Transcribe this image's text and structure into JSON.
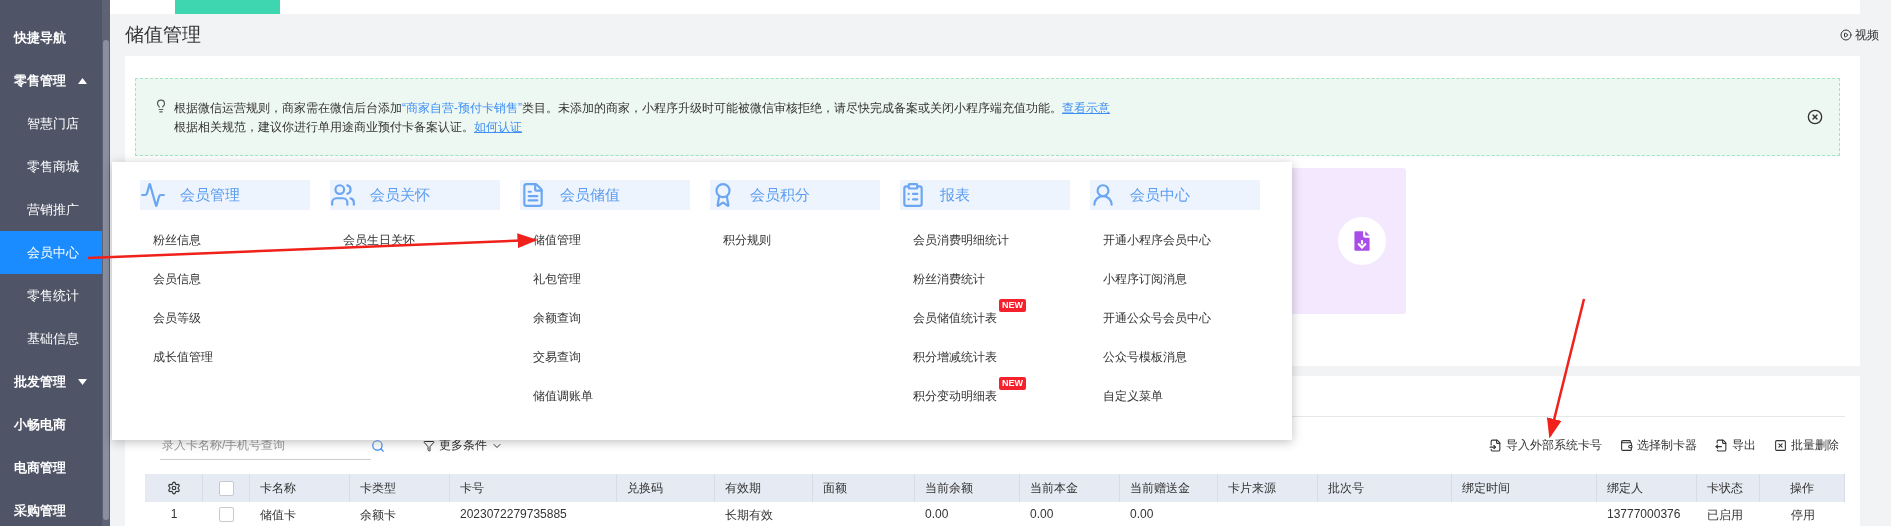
{
  "sidebar": {
    "items": [
      {
        "label": "快捷导航",
        "selected": false
      },
      {
        "label": "零售管理",
        "selected": false,
        "expanded": true,
        "children": [
          {
            "label": "智慧门店",
            "selected": false
          },
          {
            "label": "零售商城",
            "selected": false
          },
          {
            "label": "营销推广",
            "selected": false
          },
          {
            "label": "会员中心",
            "selected": true
          },
          {
            "label": "零售统计",
            "selected": false
          },
          {
            "label": "基础信息",
            "selected": false
          }
        ]
      },
      {
        "label": "批发管理",
        "selected": false,
        "expanded": false
      },
      {
        "label": "小畅电商",
        "selected": false
      },
      {
        "label": "电商管理",
        "selected": false
      },
      {
        "label": "采购管理",
        "selected": false
      }
    ]
  },
  "page": {
    "title": "储值管理",
    "video_link": "视频"
  },
  "notice": {
    "lines": [
      {
        "text_before": "根据微信运营规则，商家需在微信后台添加",
        "highlight": "“商家自营-预付卡销售”",
        "text_after": "类目。未添加的商家，小程序升级时可能被微信审核拒绝，请尽快完成备案或关闭小程序端充值功能。",
        "link": "查看示意"
      },
      {
        "text_before": "根据相关规范，建议你进行单用途商业预付卡备案认证。",
        "link": "如何认证"
      }
    ]
  },
  "mega_menu": {
    "columns": [
      {
        "title": "会员管理",
        "items": [
          {
            "label": "粉丝信息"
          },
          {
            "label": "会员信息"
          },
          {
            "label": "会员等级"
          },
          {
            "label": "成长值管理"
          }
        ]
      },
      {
        "title": "会员关怀",
        "items": [
          {
            "label": "会员生日关怀"
          }
        ]
      },
      {
        "title": "会员储值",
        "items": [
          {
            "label": "储值管理"
          },
          {
            "label": "礼包管理"
          },
          {
            "label": "余额查询"
          },
          {
            "label": "交易查询"
          },
          {
            "label": "储值调账单"
          }
        ]
      },
      {
        "title": "会员积分",
        "items": [
          {
            "label": "积分规则"
          }
        ]
      },
      {
        "title": "报表",
        "items": [
          {
            "label": "会员消费明细统计"
          },
          {
            "label": "粉丝消费统计"
          },
          {
            "label": "会员储值统计表",
            "badge": "NEW"
          },
          {
            "label": "积分增减统计表"
          },
          {
            "label": "积分变动明细表",
            "badge": "NEW"
          }
        ]
      },
      {
        "title": "会员中心",
        "items": [
          {
            "label": "开通小程序会员中心"
          },
          {
            "label": "小程序订阅消息"
          },
          {
            "label": "开通公众号会员中心"
          },
          {
            "label": "公众号模板消息"
          },
          {
            "label": "自定义菜单"
          }
        ]
      }
    ]
  },
  "toolbar": {
    "search": {
      "placeholder": "录入卡名称/手机号查询"
    },
    "filter": "更多条件",
    "actions": [
      "导入外部系统卡号",
      "选择制卡器",
      "导出",
      "批量删除"
    ]
  },
  "table": {
    "select_all": {
      "checked": false
    },
    "columns": [
      "卡名称",
      "卡类型",
      "卡号",
      "兑换码",
      "有效期",
      "面额",
      "当前余额",
      "当前本金",
      "当前赠送金",
      "卡片来源",
      "批次号",
      "绑定时间",
      "绑定人",
      "卡状态",
      "操作"
    ],
    "rows": [
      {
        "index": "1",
        "checked": false,
        "cells": [
          "储值卡",
          "余额卡",
          "2023072279735885",
          null,
          "长期有效",
          null,
          "0.00",
          "0.00",
          "0.00",
          null,
          null,
          null,
          "13777000376",
          "已启用",
          "停用"
        ]
      }
    ]
  }
}
